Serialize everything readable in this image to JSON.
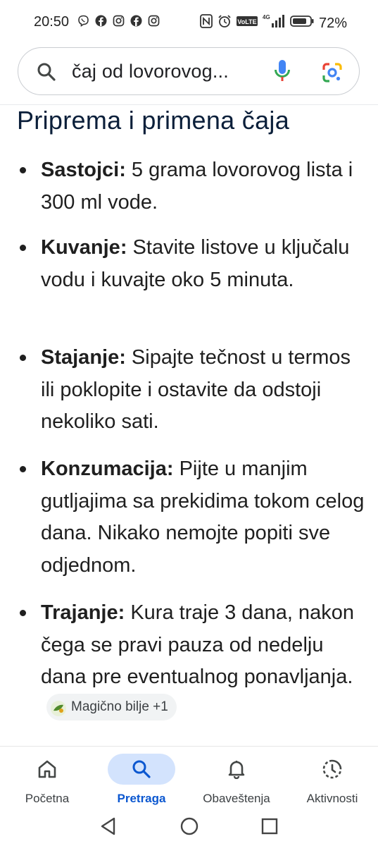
{
  "status_bar": {
    "time": "20:50",
    "left_icons": [
      "viber-icon",
      "facebook-icon",
      "instagram-icon",
      "facebook-icon",
      "instagram-icon"
    ],
    "right_icons": [
      "nfc-icon",
      "alarm-icon",
      "volte-icon",
      "signal-4g-icon",
      "battery-icon"
    ],
    "battery": "72%"
  },
  "search": {
    "query": "čaj od lovorovog..."
  },
  "content": {
    "heading": "Priprema i primena čaja",
    "items": [
      {
        "term": "Sastojci:",
        "text": " 5 grama lovorovog lista i 300 ml vode."
      },
      {
        "term": "Kuvanje:",
        "text": " Stavite listove u ključalu vodu i kuvajte oko 5 minuta."
      },
      {
        "term": "Stajanje:",
        "text": " Sipajte tečnost u termos ili poklopite i ostavite da odstoji nekoliko sati."
      },
      {
        "term": "Konzumacija:",
        "text": " Pijte u manjim gutljajima sa prekidima tokom celog dana. Nikako nemojte popiti sve odjednom."
      },
      {
        "term": "Trajanje:",
        "text": " Kura traje 3 dana, nakon čega se pravi pauza od nedelju dana pre eventualnog ponavljanja."
      }
    ],
    "source_chip": "Magično bilje +1"
  },
  "bottom_nav": {
    "items": [
      {
        "label": "Početna",
        "icon": "home-icon",
        "active": false
      },
      {
        "label": "Pretraga",
        "icon": "search-icon",
        "active": true
      },
      {
        "label": "Obaveštenja",
        "icon": "bell-icon",
        "active": false
      },
      {
        "label": "Aktivnosti",
        "icon": "activity-icon",
        "active": false
      }
    ]
  },
  "colors": {
    "accent": "#0b57d0",
    "active_pill": "#d3e3fd",
    "heading": "#0b1f3a"
  }
}
